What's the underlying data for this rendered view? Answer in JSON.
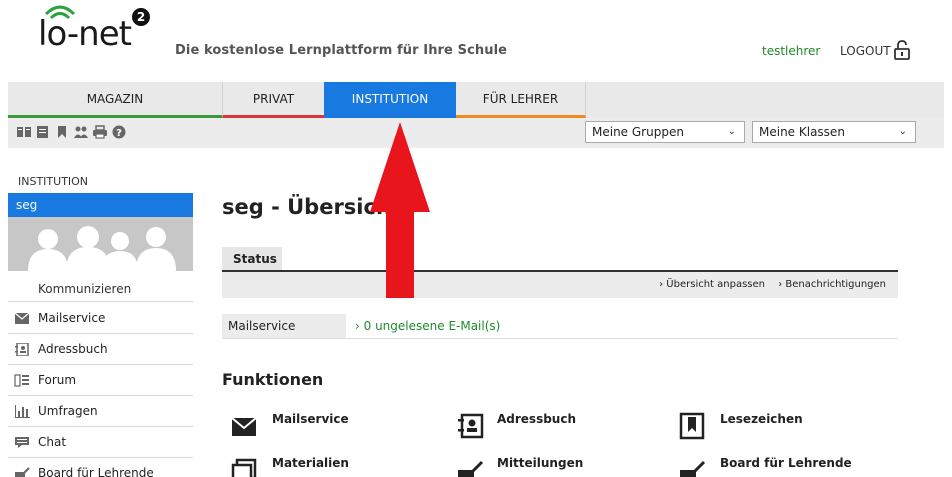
{
  "header": {
    "logo_text": "lo-net",
    "logo_sup": "2",
    "tagline": "Die kostenlose Lernplattform für Ihre Schule",
    "username": "testlehrer",
    "logout_label": "LOGOUT"
  },
  "nav": {
    "items": [
      {
        "label": "MAGAZIN"
      },
      {
        "label": "PRIVAT"
      },
      {
        "label": "INSTITUTION"
      },
      {
        "label": "FÜR LEHRER"
      }
    ]
  },
  "toolbar": {
    "groups_select": "Meine Gruppen",
    "classes_select": "Meine Klassen"
  },
  "sidebar": {
    "section_title": "INSTITUTION",
    "active_item": "seg",
    "communicate_label": "Kommunizieren",
    "items": [
      {
        "label": "Mailservice",
        "icon": "envelope-icon"
      },
      {
        "label": "Adressbuch",
        "icon": "addressbook-icon"
      },
      {
        "label": "Forum",
        "icon": "forum-icon"
      },
      {
        "label": "Umfragen",
        "icon": "poll-icon"
      },
      {
        "label": "Chat",
        "icon": "chat-icon"
      },
      {
        "label": "Board für Lehrende",
        "icon": "board-icon"
      }
    ]
  },
  "main": {
    "title": "seg - Übersicht",
    "status_tab": "Status",
    "link_customize": "Übersicht anpassen",
    "link_notifications": "Benachrichtigungen",
    "mail_label": "Mailservice",
    "mail_value": "0 ungelesene E-Mail(s)",
    "functions_title": "Funktionen",
    "functions": [
      {
        "label": "Mailservice",
        "icon": "envelope-icon"
      },
      {
        "label": "Adressbuch",
        "icon": "addressbook-icon"
      },
      {
        "label": "Lesezeichen",
        "icon": "bookmark-icon"
      },
      {
        "label": "Materialien",
        "icon": "materials-icon"
      },
      {
        "label": "Mitteilungen",
        "icon": "megaphone-icon"
      },
      {
        "label": "Board für Lehrende",
        "icon": "board-icon"
      }
    ]
  },
  "colors": {
    "accent_blue": "#1879e0",
    "green": "#3a9a3a",
    "red": "#d9363e",
    "orange": "#f08a21",
    "arrow_red": "#e8161c"
  }
}
